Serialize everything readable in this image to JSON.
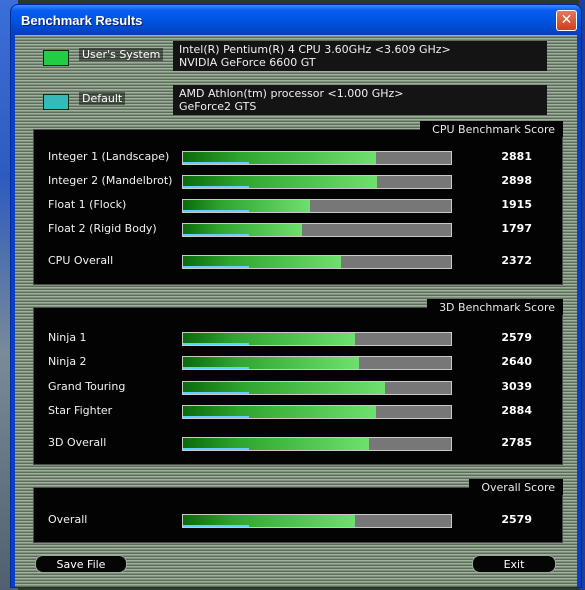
{
  "window": {
    "title": "Benchmark Results",
    "close_glyph": "✕"
  },
  "systems": [
    {
      "label": "User's System",
      "color": "#22cc44",
      "info_line1": "Intel(R) Pentium(R) 4 CPU 3.60GHz <3.609 GHz>",
      "info_line2": "NVIDIA GeForce 6600 GT"
    },
    {
      "label": "Default",
      "color": "#33bbbb",
      "info_line1": "AMD Athlon(tm) processor <1.000 GHz>",
      "info_line2": "GeForce2 GTS"
    }
  ],
  "cpu": {
    "title": "CPU Benchmark Score",
    "rows": [
      {
        "label": "Integer 1 (Landscape)",
        "score": "2881",
        "level": 0.72
      },
      {
        "label": "Integer 2 (Mandelbrot)",
        "score": "2898",
        "level": 0.725
      },
      {
        "label": "Float 1 (Flock)",
        "score": "1915",
        "level": 0.475
      },
      {
        "label": "Float 2 (Rigid Body)",
        "score": "1797",
        "level": 0.445
      },
      {
        "label": "CPU Overall",
        "score": "2372",
        "level": 0.59
      }
    ]
  },
  "d3": {
    "title": "3D Benchmark Score",
    "rows": [
      {
        "label": "Ninja 1",
        "score": "2579",
        "level": 0.64
      },
      {
        "label": "Ninja 2",
        "score": "2640",
        "level": 0.655
      },
      {
        "label": "Grand Touring",
        "score": "3039",
        "level": 0.755
      },
      {
        "label": "Star Fighter",
        "score": "2884",
        "level": 0.72
      },
      {
        "label": "3D Overall",
        "score": "2785",
        "level": 0.695
      }
    ]
  },
  "overall": {
    "title": "Overall Score",
    "rows": [
      {
        "label": "Overall",
        "score": "2579",
        "level": 0.64
      }
    ]
  },
  "buttons": {
    "save": "Save File",
    "exit": "Exit"
  }
}
